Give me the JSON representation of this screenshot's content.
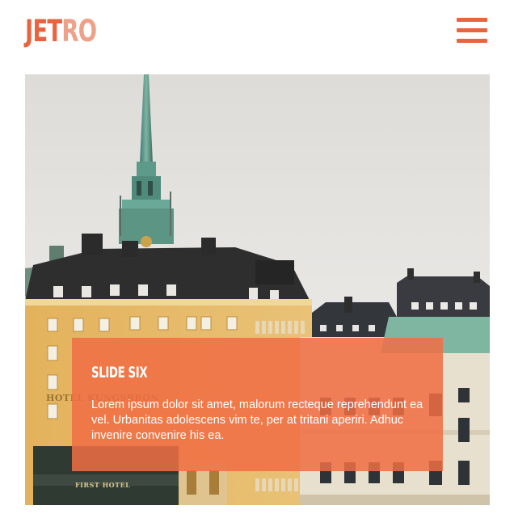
{
  "header": {
    "logo_part_a": "JET",
    "logo_part_b": "RO",
    "menu_icon": "hamburger-menu-icon"
  },
  "slide": {
    "title": "SLIDE SIX",
    "text": "Lorem ipsum dolor sit amet, malorum recteque reprehendunt ea vel. Urbanitas adolescens vim te, per at tritani aperiri. Adhuc invenire convenire his ea.",
    "sign_left": "HOTEL KUNGSBRON",
    "sign_bottom": "FIRST HOTEL"
  },
  "colors": {
    "accent": "#e8643f",
    "accent_light": "#eea088",
    "caption_bg": "#f06e44"
  }
}
